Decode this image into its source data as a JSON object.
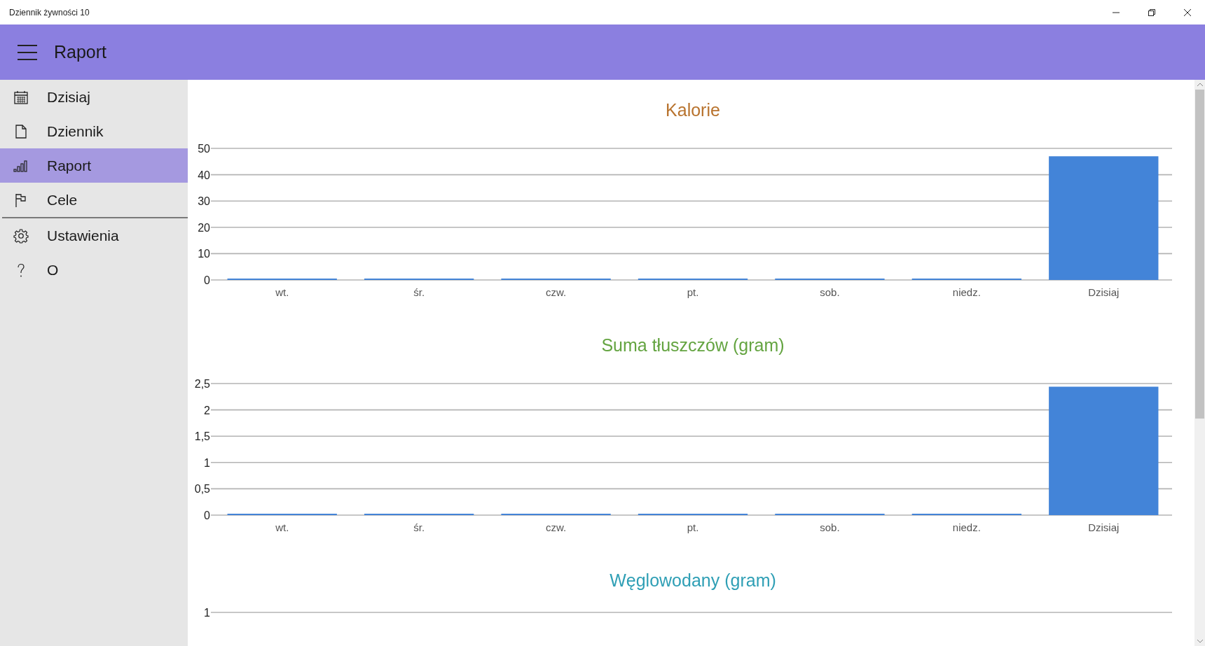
{
  "window": {
    "title": "Dziennik żywności 10"
  },
  "header": {
    "title": "Raport"
  },
  "sidebar": {
    "items": [
      {
        "label": "Dzisiaj",
        "selected": false
      },
      {
        "label": "Dziennik",
        "selected": false
      },
      {
        "label": "Raport",
        "selected": true
      },
      {
        "label": "Cele",
        "selected": false
      }
    ],
    "bottom_items": [
      {
        "label": "Ustawienia",
        "selected": false
      },
      {
        "label": "O",
        "selected": false
      }
    ]
  },
  "charts": [
    {
      "color": "#b8732e",
      "chart_data": {
        "type": "bar",
        "title": "Kalorie",
        "categories": [
          "wt.",
          "śr.",
          "czw.",
          "pt.",
          "sob.",
          "niedz.",
          "Dzisiaj"
        ],
        "series": [
          {
            "color": "#4384d8",
            "values": [
              0,
              0,
              0,
              0,
              0,
              0,
              47
            ]
          }
        ],
        "grid": true,
        "ylim": [
          0,
          50
        ],
        "yticks": [
          0,
          10,
          20,
          30,
          40,
          50
        ]
      }
    },
    {
      "color": "#64a441",
      "chart_data": {
        "type": "bar",
        "title": "Suma tłuszczów (gram)",
        "categories": [
          "wt.",
          "śr.",
          "czw.",
          "pt.",
          "sob.",
          "niedz.",
          "Dzisiaj"
        ],
        "series": [
          {
            "color": "#4384d8",
            "values": [
              0,
              0,
              0,
              0,
              0,
              0,
              2.44
            ]
          }
        ],
        "grid": true,
        "ylim": [
          0,
          2.5
        ],
        "yticks": [
          0,
          {
            "value": 0.5,
            "label": "0,5"
          },
          1,
          {
            "value": 1.5,
            "label": "1,5"
          },
          2,
          {
            "value": 2.5,
            "label": "2,5"
          }
        ]
      }
    },
    {
      "color": "#2f9fb5",
      "chart_data": {
        "type": "other",
        "title": "Węglowodany (gram)",
        "annotations": [
          {
            "text": "1"
          }
        ]
      }
    }
  ]
}
